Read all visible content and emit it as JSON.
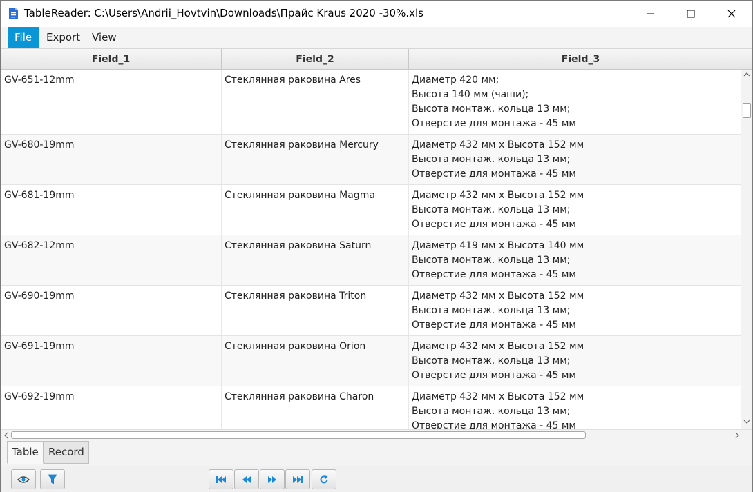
{
  "window": {
    "title": "TableReader: C:\\Users\\Andrii_Hovtvin\\Downloads\\Прайс Kraus 2020 -30%.xls",
    "app_icon": "document-icon",
    "controls": [
      "minimize-icon",
      "maximize-icon",
      "close-icon"
    ]
  },
  "menu": {
    "file": "File",
    "export": "Export",
    "view": "View"
  },
  "table": {
    "columns": [
      "Field_1",
      "Field_2",
      "Field_3"
    ],
    "rows": [
      {
        "f1": "GV-651-12mm",
        "f2": "Стеклянная раковина Ares",
        "f3": [
          "Диаметр 420 мм;",
          "Высота 140 мм (чаши);",
          "Высота монтаж. кольца 13 мм;",
          "Отверстие для монтажа - 45 мм"
        ]
      },
      {
        "f1": "GV-680-19mm",
        "f2": "Стеклянная раковина Mercury",
        "f3": [
          "Диаметр 432 мм х Высота 152 мм",
          "Высота монтаж. кольца 13 мм;",
          "Отверстие для монтажа - 45 мм"
        ]
      },
      {
        "f1": "GV-681-19mm",
        "f2": "Стеклянная раковина Magma",
        "f3": [
          "Диаметр 432 мм х Высота 152 мм",
          "Высота монтаж. кольца 13 мм;",
          "Отверстие для монтажа - 45 мм"
        ]
      },
      {
        "f1": "GV-682-12mm",
        "f2": "Стеклянная раковина Saturn",
        "f3": [
          "Диаметр 419 мм х Высота 140 мм",
          "Высота монтаж. кольца 13 мм;",
          "Отверстие для монтажа - 45 мм"
        ]
      },
      {
        "f1": "GV-690-19mm",
        "f2": "Стеклянная раковина Triton",
        "f3": [
          "Диаметр 432 мм х Высота 152 мм",
          "Высота монтаж. кольца 13 мм;",
          "Отверстие для монтажа - 45 мм"
        ]
      },
      {
        "f1": "GV-691-19mm",
        "f2": "Стеклянная раковина Orion",
        "f3": [
          "Диаметр 432 мм х Высота 152 мм",
          "Высота монтаж. кольца 13 мм;",
          "Отверстие для монтажа - 45 мм"
        ]
      },
      {
        "f1": "GV-692-19mm",
        "f2": "Стеклянная раковина Charon",
        "f3": [
          "Диаметр 432 мм х Высота 152 мм",
          "Высота монтаж. кольца 13 мм;",
          "Отверстие для монтажа - 45 мм"
        ]
      }
    ]
  },
  "tabs": {
    "table": "Table",
    "record": "Record"
  },
  "toolbar": {
    "icons": [
      "eye-icon",
      "filter-icon",
      "first-page-icon",
      "previous-page-icon",
      "next-page-icon",
      "last-page-icon",
      "refresh-icon"
    ]
  },
  "colors": {
    "accent": "#0a96d6",
    "toolbar_icon": "#1e88d8"
  }
}
